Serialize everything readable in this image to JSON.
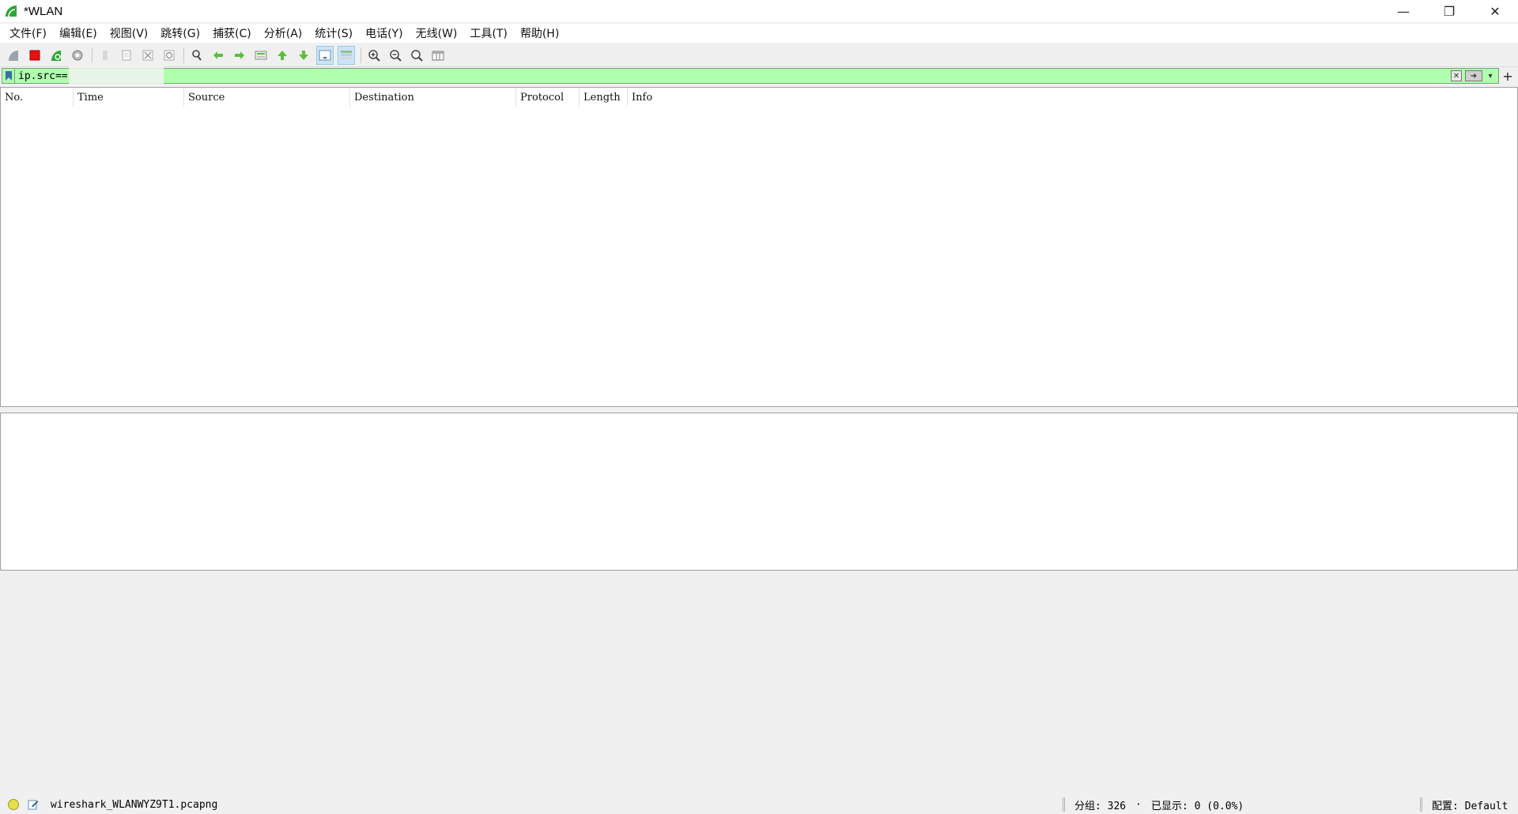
{
  "window": {
    "title": "*WLAN",
    "controls": {
      "minimize": "—",
      "restore": "❐",
      "close": "✕"
    }
  },
  "menu": [
    {
      "label": "文件(F)"
    },
    {
      "label": "编辑(E)"
    },
    {
      "label": "视图(V)"
    },
    {
      "label": "跳转(G)"
    },
    {
      "label": "捕获(C)"
    },
    {
      "label": "分析(A)"
    },
    {
      "label": "统计(S)"
    },
    {
      "label": "电话(Y)"
    },
    {
      "label": "无线(W)"
    },
    {
      "label": "工具(T)"
    },
    {
      "label": "帮助(H)"
    }
  ],
  "toolbar": {
    "icons": [
      "start-capture-icon",
      "stop-capture-icon",
      "restart-capture-icon",
      "capture-options-icon",
      "open-file-icon",
      "save-file-icon",
      "close-file-icon",
      "reload-file-icon",
      "find-packet-icon",
      "go-back-icon",
      "go-forward-icon",
      "go-to-packet-icon",
      "go-first-icon",
      "go-last-icon",
      "autoscroll-icon",
      "colorize-icon",
      "zoom-in-icon",
      "zoom-out-icon",
      "zoom-normal-icon",
      "resize-columns-icon"
    ]
  },
  "filter": {
    "value": "ip.src==",
    "clear_icon": "clear-filter-icon",
    "apply_icon": "apply-filter-icon",
    "dropdown_icon": "chevron-down-icon",
    "add_label": "+"
  },
  "packet_list": {
    "columns": [
      "No.",
      "Time",
      "Source",
      "Destination",
      "Protocol",
      "Length",
      "Info"
    ]
  },
  "status": {
    "file": "wireshark_WLANWYZ9T1.pcapng",
    "packets_label": "分组: 326",
    "dot_sep": "·",
    "displayed_label": "已显示: 0 (0.0%)",
    "profile_label": "配置: Default"
  },
  "colors": {
    "filter_bg": "#afffaf",
    "stop_red": "#e81010",
    "shark_green": "#2ea836"
  }
}
